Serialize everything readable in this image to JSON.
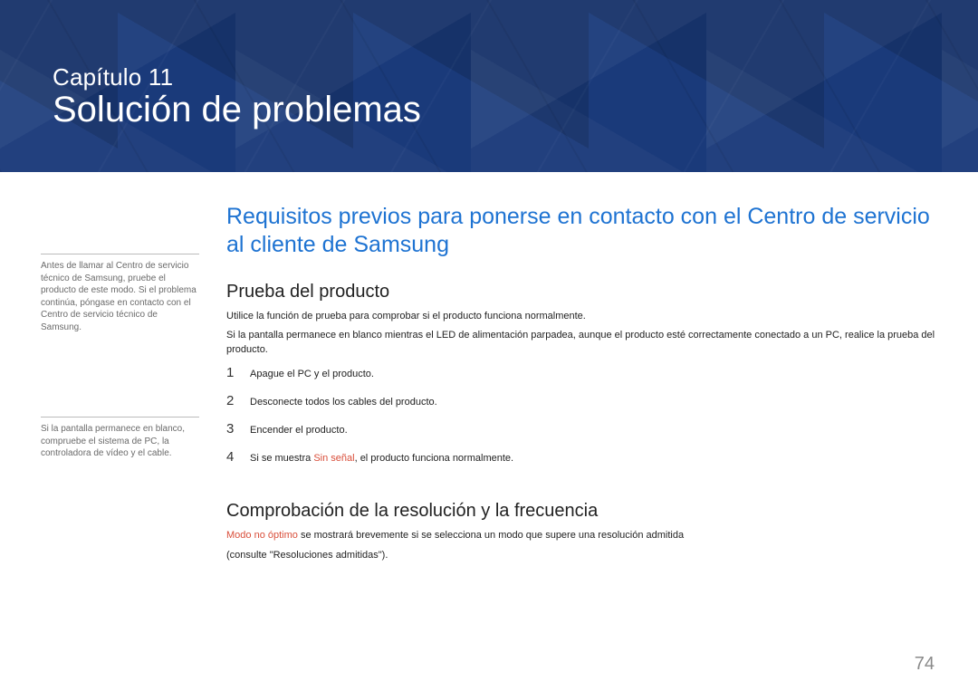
{
  "hero": {
    "chapter_label": "Capítulo 11",
    "chapter_title": "Solución de problemas"
  },
  "sidebar": {
    "note1": "Antes de llamar al Centro de servicio técnico de Samsung, pruebe el producto de este modo. Si el problema continúa, póngase en contacto con el Centro de servicio técnico de Samsung.",
    "note2": "Si la pantalla permanece en blanco, compruebe el sistema de PC, la controladora de vídeo y el cable."
  },
  "main": {
    "heading_primary": "Requisitos previos para ponerse en contacto con el Centro de servicio al cliente de Samsung",
    "section1": {
      "heading": "Prueba del producto",
      "p1": "Utilice la función de prueba para comprobar si el producto funciona normalmente.",
      "p2": "Si la pantalla permanece en blanco mientras el LED de alimentación parpadea, aunque el producto esté correctamente conectado a un PC, realice la prueba del producto.",
      "steps": [
        {
          "num": "1",
          "text": "Apague el PC y el producto."
        },
        {
          "num": "2",
          "text": "Desconecte todos los cables del producto."
        },
        {
          "num": "3",
          "text": "Encender el producto."
        },
        {
          "num": "4",
          "prefix": "Si se muestra ",
          "red": "Sin señal",
          "suffix": ", el producto funciona normalmente."
        }
      ]
    },
    "section2": {
      "heading": "Comprobación de la resolución y la frecuencia",
      "p1_red": "Modo no óptimo",
      "p1_rest": " se mostrará brevemente si se selecciona un modo que supere una resolución admitida",
      "p2": "(consulte \"Resoluciones admitidas\")."
    }
  },
  "page_number": "74"
}
